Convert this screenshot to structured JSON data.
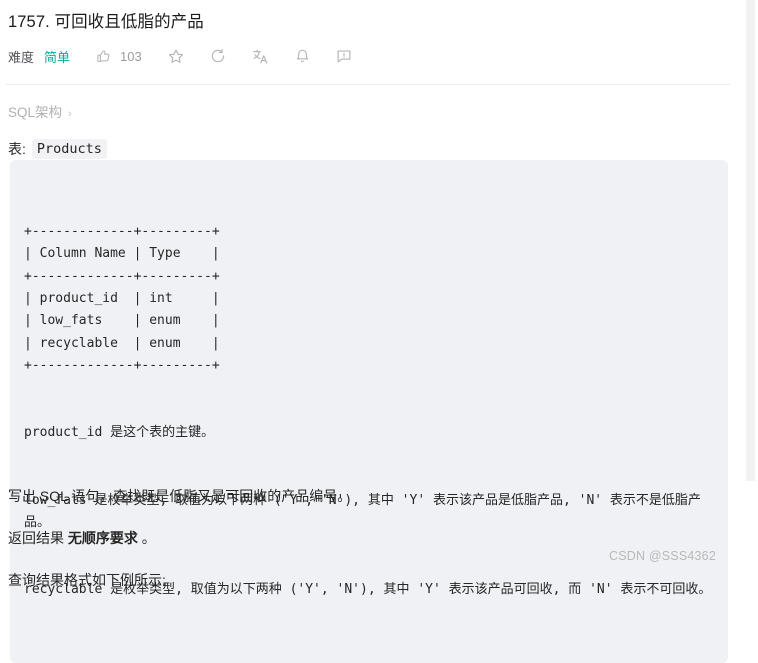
{
  "problem": {
    "title": "1757. 可回收且低脂的产品",
    "difficulty_label": "难度",
    "difficulty_value": "简单",
    "like_count": "103",
    "actions": [
      {
        "name": "thumbs-up-icon",
        "label": "103"
      },
      {
        "name": "star-icon",
        "label": ""
      },
      {
        "name": "reset-icon",
        "label": ""
      },
      {
        "name": "translate-icon",
        "label": ""
      },
      {
        "name": "bell-icon",
        "label": ""
      },
      {
        "name": "comment-icon",
        "label": ""
      }
    ]
  },
  "schema": {
    "toggle_label": "SQL架构",
    "toggle_chevron": "›"
  },
  "table_intro": {
    "prefix": "表:",
    "table_name": "Products"
  },
  "code_block": {
    "ascii_table": "+-------------+---------+\n| Column Name | Type    |\n+-------------+---------+\n| product_id  | int     |\n| low_fats    | enum    |\n| recyclable  | enum    |\n+-------------+---------+",
    "line_primary_key": "product_id 是这个表的主键。",
    "line_low_fats": "low_fats 是枚举类型, 取值为以下两种 ('Y', 'N'), 其中 'Y' 表示该产品是低脂产品, 'N' 表示不是低脂产品。",
    "line_recyclable": "recyclable 是枚举类型, 取值为以下两种 ('Y', 'N'), 其中 'Y' 表示该产品可回收, 而 'N' 表示不可回收。"
  },
  "prose": {
    "task": "写出 SQL 语句，查找既是低脂又是可回收的产品编号。",
    "order_prefix": "返回结果 ",
    "order_bold": "无顺序要求",
    "order_suffix": " 。",
    "example_intro": "查询结果格式如下例所示:"
  },
  "watermark": {
    "text": "CSDN @SSS4362"
  },
  "colors": {
    "difficulty_green": "#00af9b",
    "code_block_bg": "#f0f1f4",
    "text": "#262626",
    "muted": "#b0b0b0"
  }
}
